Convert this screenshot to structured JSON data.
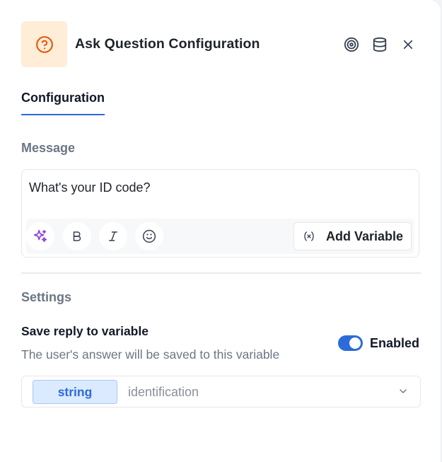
{
  "header": {
    "title": "Ask Question Configuration",
    "icons": [
      "question-circle-icon",
      "target-icon",
      "database-icon",
      "close-icon"
    ],
    "accent": "#e8590c",
    "icon_bg": "#ffedd8"
  },
  "tabs": [
    {
      "label": "Configuration",
      "active": true
    }
  ],
  "message": {
    "label": "Message",
    "text": "What's your ID code?",
    "toolbar": {
      "buttons": [
        "sparkles-icon",
        "bold-icon",
        "italic-icon",
        "emoji-icon"
      ],
      "add_variable_label": "Add Variable"
    }
  },
  "settings": {
    "label": "Settings",
    "save_reply": {
      "title": "Save reply to variable",
      "description": "The user's answer will be saved to this variable",
      "toggle_label": "Enabled",
      "enabled": true
    },
    "variable": {
      "type": "string",
      "name": "identification"
    }
  },
  "colors": {
    "primary": "#2d6bd8",
    "muted_text": "#6b7684",
    "ai_purple": "#8b3fd9"
  }
}
